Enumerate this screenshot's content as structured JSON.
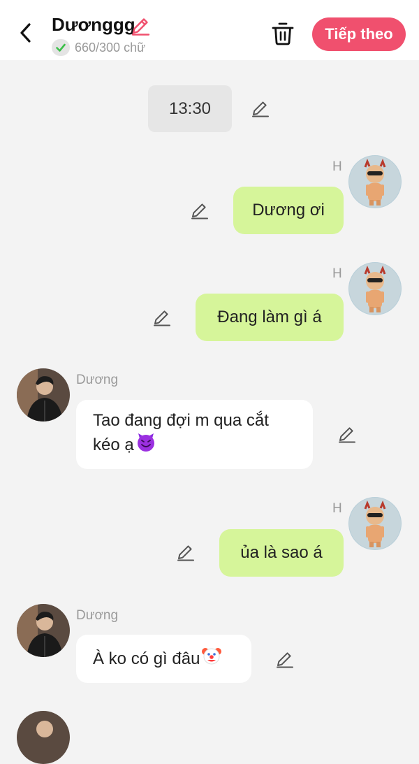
{
  "header": {
    "title": "Dươnggg",
    "char_count": "660/300 chữ",
    "next_label": "Tiếp theo",
    "accent_color": "#f0506e",
    "check_color": "#3cbf4a"
  },
  "time_marker": "13:30",
  "participants": {
    "me": {
      "tag": "H"
    },
    "them": {
      "name": "Dương"
    }
  },
  "messages": [
    {
      "from": "me",
      "text": "Dương ơi"
    },
    {
      "from": "me",
      "text": "Đang làm gì á"
    },
    {
      "from": "them",
      "line1": "Tao đang đợi m qua cắt",
      "line2": "kéo ạ",
      "emoji": "smiling-devil-emoji"
    },
    {
      "from": "me",
      "text": "ủa là sao á"
    },
    {
      "from": "them",
      "text": "À ko có gì đâu",
      "emoji": "clown-face-emoji"
    }
  ],
  "icons": [
    "chevron-left-icon",
    "pencil-icon",
    "check-icon",
    "trash-icon",
    "edit-icon"
  ],
  "colors": {
    "my_bubble": "#d6f59a",
    "their_bubble": "#ffffff",
    "background": "#f3f3f3"
  }
}
